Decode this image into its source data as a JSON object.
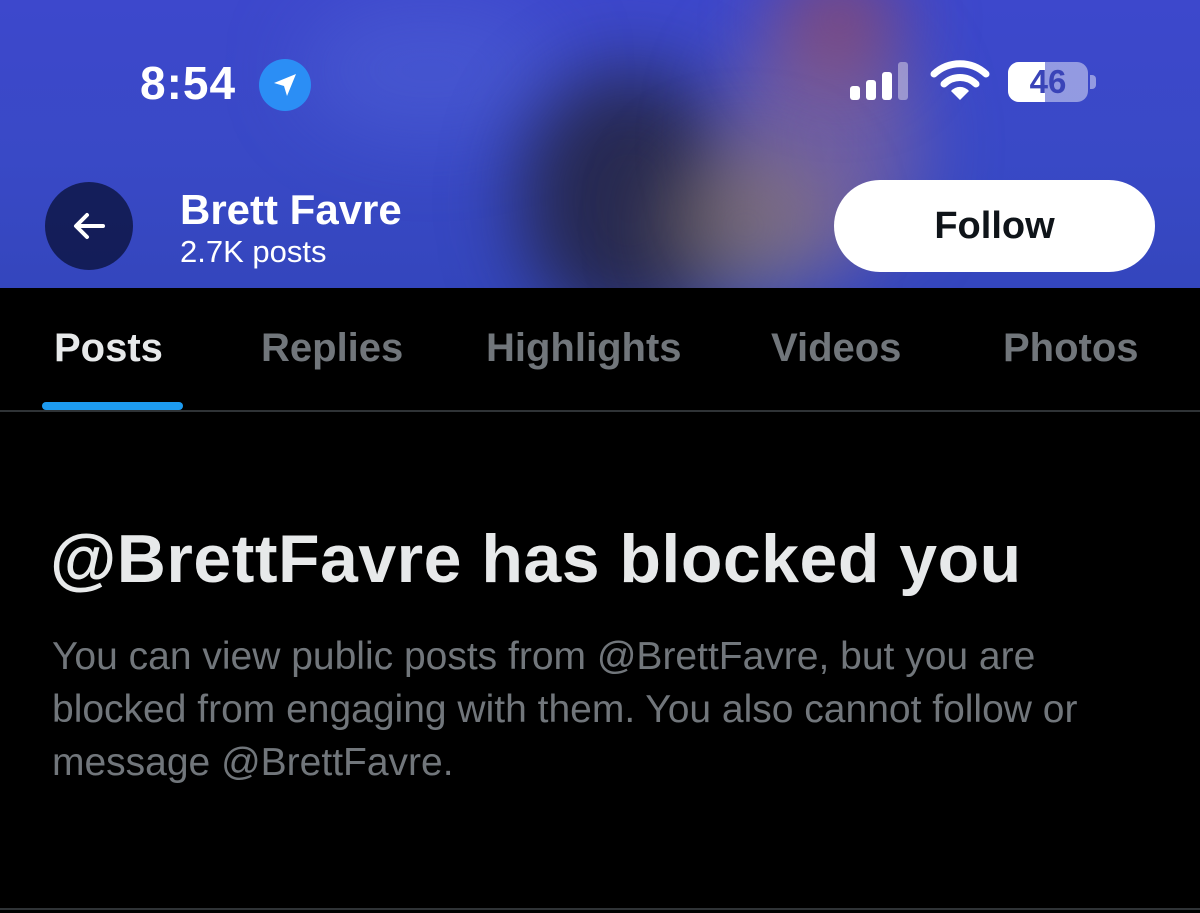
{
  "status_bar": {
    "time": "8:54",
    "battery": "46",
    "battery_level": 0.46,
    "location_icon": "location-arrow-icon",
    "signal_icon": "cellular-signal-icon",
    "wifi_icon": "wifi-icon"
  },
  "header": {
    "back_icon": "arrow-left-icon",
    "name": "Brett Favre",
    "posts_count": "2.7K posts",
    "follow_label": "Follow"
  },
  "tabs": [
    {
      "label": "Posts",
      "active": true
    },
    {
      "label": "Replies",
      "active": false
    },
    {
      "label": "Highlights",
      "active": false
    },
    {
      "label": "Videos",
      "active": false
    },
    {
      "label": "Photos",
      "active": false
    }
  ],
  "blocked": {
    "title": "@BrettFavre has blocked you",
    "body": "You can view public posts from @BrettFavre, but you are blocked from engaging with them. You also cannot follow or message @BrettFavre."
  },
  "colors": {
    "accent": "#1d9bf0",
    "banner": "#3d48cc",
    "text_primary": "#e7e9ea",
    "text_secondary": "#71767b",
    "background": "#000000"
  }
}
